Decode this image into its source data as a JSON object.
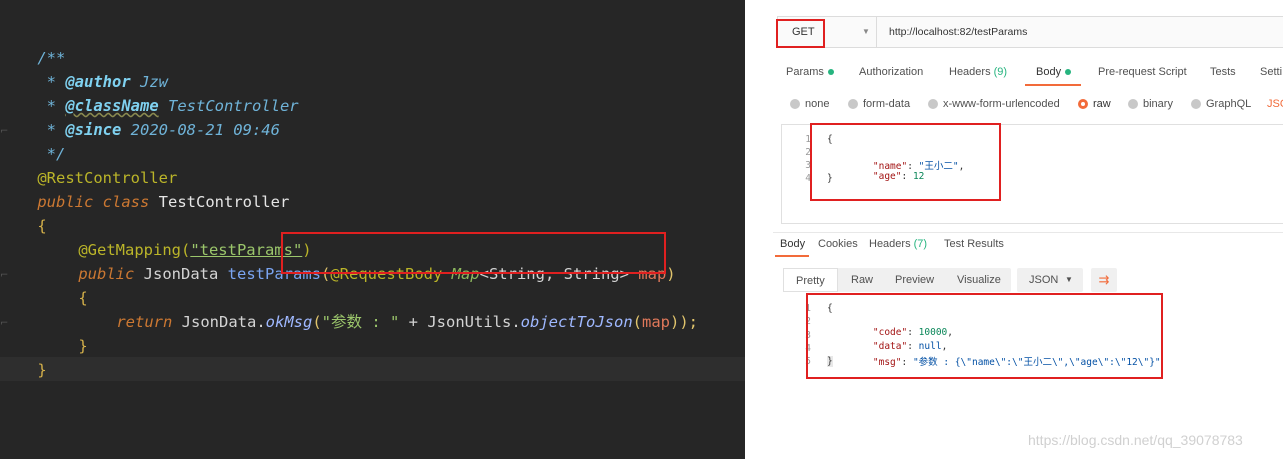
{
  "editor": {
    "lines": {
      "l1": "/**",
      "l2_star": " * ",
      "l2_tag": "@author",
      "l2_val": " Jzw",
      "l3_star": " * ",
      "l3_tag": "@className",
      "l3_val": " TestController",
      "l4_star": " * ",
      "l4_tag": "@since",
      "l4_val": " 2020-08-21 09:46",
      "l5": " */",
      "l6": "@RestController",
      "l7_kw1": "public",
      "l7_kw2": " class",
      "l7_name": " TestController",
      "l8": "{",
      "l9_annot": "@GetMapping(",
      "l9_str": "\"testParams\"",
      "l9_close": ")",
      "l10_kw": "public",
      "l10_type": " JsonData",
      "l10_fn": " testParams",
      "l10_open": "(",
      "l10_annot": "@RequestBody",
      "l10_map": " Map",
      "l10_generic": "<String, String>",
      "l10_param": " map",
      "l10_close": ")",
      "l11": "{",
      "l12_kw": "return",
      "l12_cls": " JsonData.",
      "l12_fn": "okMsg",
      "l12_open": "(",
      "l12_str": "\"参数 : \"",
      "l12_plus": " + JsonUtils.",
      "l12_fn2": "objectToJson",
      "l12_arg_open": "(",
      "l12_arg": "map",
      "l12_end": "));",
      "l13": "}",
      "l14": "}"
    }
  },
  "postman": {
    "method": "GET",
    "url": "http://localhost:82/testParams",
    "request_tabs": {
      "params": "Params",
      "authorization": "Authorization",
      "headers": "Headers",
      "headers_count": "(9)",
      "body": "Body",
      "prerequest": "Pre-request Script",
      "tests": "Tests",
      "settings": "Setti"
    },
    "body_types": {
      "none": "none",
      "formdata": "form-data",
      "urlencoded": "x-www-form-urlencoded",
      "raw": "raw",
      "binary": "binary",
      "graphql": "GraphQL",
      "json": "JSO"
    },
    "request_body": {
      "n1": "1",
      "n2": "2",
      "n3": "3",
      "n4": "4",
      "open": "{",
      "name_key": "\"name\"",
      "name_val": "\"王小二\"",
      "age_key": "\"age\"",
      "age_val": "12",
      "close": "}"
    },
    "response_tabs": {
      "body": "Body",
      "cookies": "Cookies",
      "headers": "Headers",
      "headers_count": "(7)",
      "tests": "Test Results"
    },
    "view_options": {
      "pretty": "Pretty",
      "raw": "Raw",
      "preview": "Preview",
      "visualize": "Visualize",
      "format": "JSON",
      "chevron": "▼",
      "wrap": "⇉"
    },
    "response_body": {
      "n1": "1",
      "n2": "2",
      "n3": "3",
      "n4": "4",
      "n5": "5",
      "open": "{",
      "code_key": "\"code\"",
      "code_val": "10000",
      "data_key": "\"data\"",
      "data_val": "null",
      "msg_key": "\"msg\"",
      "msg_val": "\"参数 : {\\\"name\\\":\\\"王小二\\\",\\\"age\\\":\\\"12\\\"}\"",
      "close": "}"
    },
    "watermark": "https://blog.csdn.net/qq_39078783"
  },
  "colors": {
    "highlight_box": "#e02020",
    "accent": "#f26b3a",
    "status_green": "#26b47f"
  }
}
